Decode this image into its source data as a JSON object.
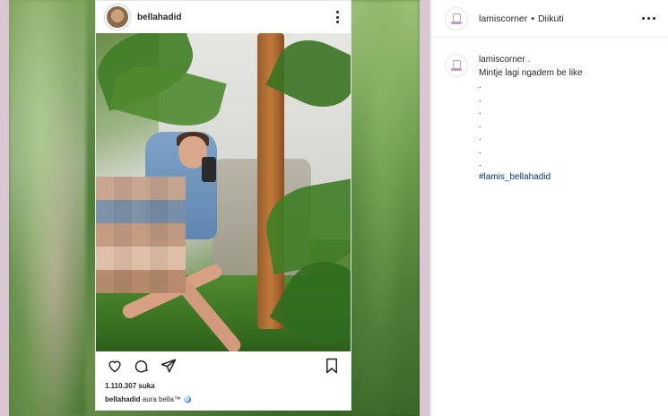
{
  "embedded_post": {
    "username": "bellahadid",
    "likes": "1.110.307 suka",
    "caption_user": "bellahadid",
    "caption_text": "aura bella™ 🪩"
  },
  "sidebar": {
    "username": "lamiscorner",
    "separator": "•",
    "follow_status": "Diikuti",
    "comment": {
      "username": "lamiscorner",
      "username_suffix": " .",
      "lines": [
        "Mintje lagi ngadem be like",
        ".",
        ".",
        ".",
        ".",
        ".",
        ".",
        "."
      ],
      "hashtag": "#lamis_bellahadid"
    }
  },
  "icons": {
    "kebab": "more-vertical-icon",
    "menu": "more-horizontal-icon",
    "like": "heart-icon",
    "comment": "comment-icon",
    "share": "send-icon",
    "save": "bookmark-icon"
  },
  "colors": {
    "border": "#efefef",
    "text": "#262626",
    "hashtag": "#00376b",
    "frame": "#d9c6d2"
  }
}
